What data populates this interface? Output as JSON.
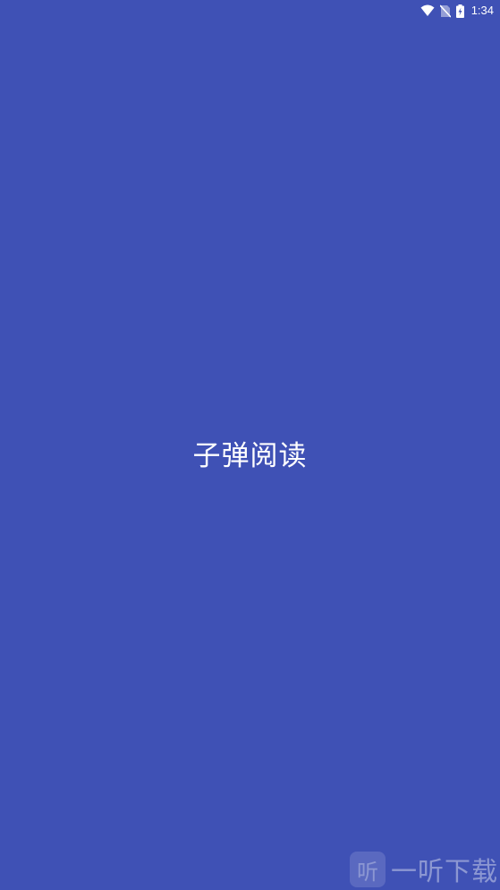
{
  "status_bar": {
    "time": "1:34",
    "icons": [
      "wifi-icon",
      "no-sim-icon",
      "battery-charging-icon"
    ]
  },
  "splash": {
    "app_name": "子弹阅读"
  },
  "watermark": {
    "logo_glyph": "听",
    "text": "一听下载"
  },
  "colors": {
    "background": "#3f51b5",
    "text": "#ffffff"
  }
}
